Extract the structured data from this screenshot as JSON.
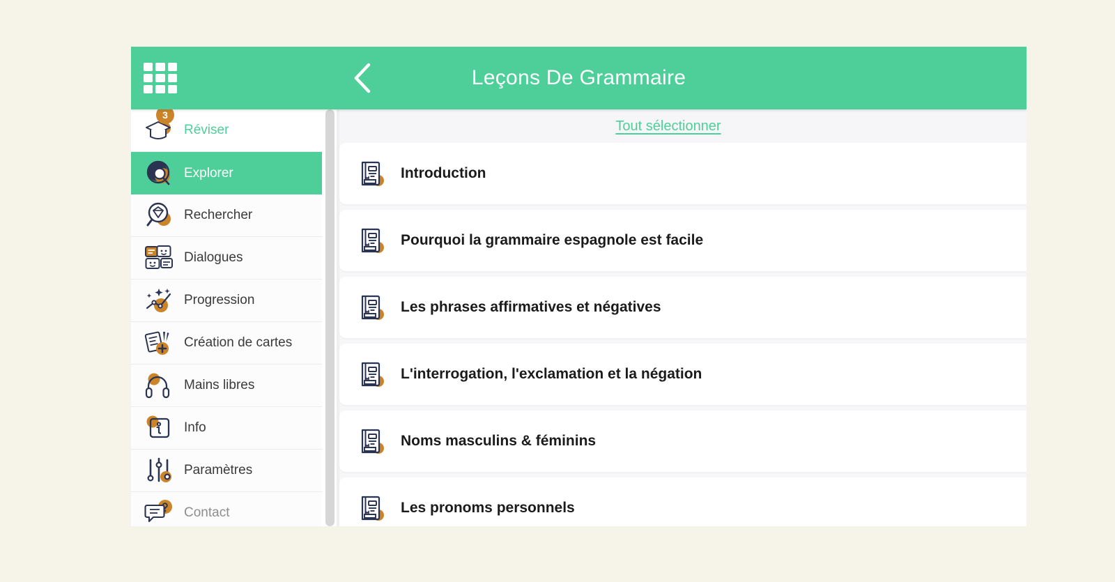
{
  "window": {
    "background_color": "#f6f3e9",
    "accent_color": "#4ecf99",
    "badge_color": "#cc8429"
  },
  "header": {
    "grid_icon": "grid-menu-icon",
    "back_icon": "chevron-left-icon",
    "title": "Leçons De Grammaire"
  },
  "sidebar": {
    "items": [
      {
        "label": "Réviser",
        "icon": "graduation-cap-icon",
        "badge": "3",
        "state": "accent"
      },
      {
        "label": "Explorer",
        "icon": "explore-search-icon",
        "badge": "",
        "state": "active"
      },
      {
        "label": "Rechercher",
        "icon": "magnifier-gem-icon",
        "badge": "",
        "state": "normal"
      },
      {
        "label": "Dialogues",
        "icon": "chat-faces-icon",
        "badge": "",
        "state": "normal"
      },
      {
        "label": "Progression",
        "icon": "chart-sparkle-icon",
        "badge": "",
        "state": "normal"
      },
      {
        "label": "Création de cartes",
        "icon": "card-plus-icon",
        "badge": "",
        "state": "normal"
      },
      {
        "label": "Mains libres",
        "icon": "headphones-icon",
        "badge": "",
        "state": "normal"
      },
      {
        "label": "Info",
        "icon": "info-square-icon",
        "badge": "",
        "state": "normal"
      },
      {
        "label": "Paramètres",
        "icon": "sliders-icon",
        "badge": "",
        "state": "normal"
      },
      {
        "label": "Contact",
        "icon": "chat-question-icon",
        "badge": "",
        "state": "muted"
      }
    ]
  },
  "content": {
    "select_all_label": "Tout sélectionner",
    "lessons": [
      {
        "title": "Introduction",
        "icon": "book-lesson-icon"
      },
      {
        "title": "Pourquoi la grammaire espagnole est facile",
        "icon": "book-lesson-icon"
      },
      {
        "title": "Les phrases affirmatives et négatives",
        "icon": "book-lesson-icon"
      },
      {
        "title": "L'interrogation, l'exclamation et la négation",
        "icon": "book-lesson-icon"
      },
      {
        "title": "Noms masculins & féminins",
        "icon": "book-lesson-icon"
      },
      {
        "title": "Les pronoms personnels",
        "icon": "book-lesson-icon"
      }
    ]
  }
}
